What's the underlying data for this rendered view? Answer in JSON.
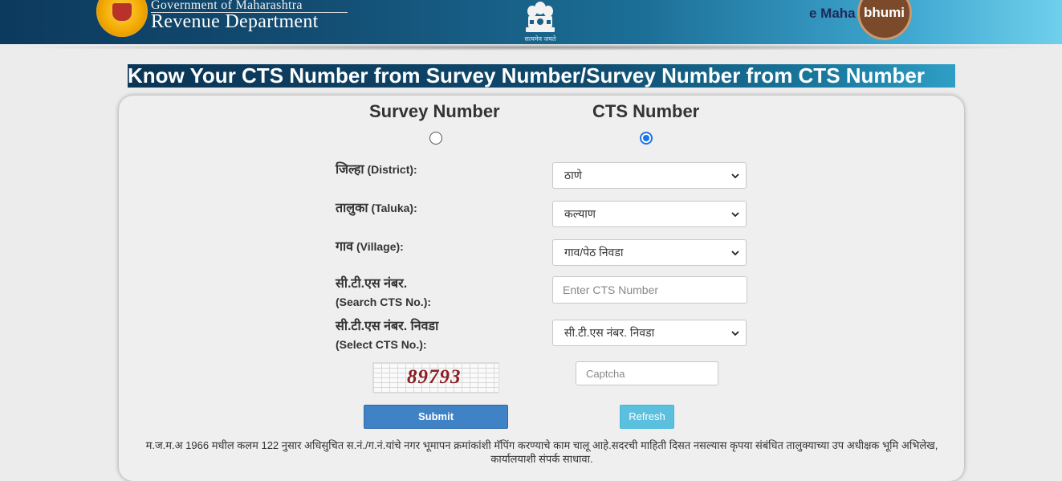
{
  "header": {
    "gov_line1": "Government of Maharashtra",
    "gov_line2": "Revenue Department",
    "emblem_caption": "सत्यमेव जयते",
    "brand_prefix": "e Maha",
    "brand_suffix": "bhumi"
  },
  "page_title": "Know Your CTS Number from Survey Number/Survey Number from CTS Number",
  "search_mode": {
    "options": [
      {
        "label": "Survey Number",
        "checked": false
      },
      {
        "label": "CTS Number",
        "checked": true
      }
    ]
  },
  "form": {
    "district": {
      "label_hi": "जिल्हा",
      "label_en": "(District):",
      "selected": "ठाणे"
    },
    "taluka": {
      "label_hi": "तालुका",
      "label_en": "(Taluka):",
      "selected": "कल्याण"
    },
    "village": {
      "label_hi": "गाव",
      "label_en": "(Village):",
      "selected": "गाव/पेठ निवडा"
    },
    "search_cts": {
      "label_hi": "सी.टी.एस नंबर.",
      "label_en": "(Search CTS No.):",
      "placeholder": "Enter CTS Number"
    },
    "select_cts": {
      "label_hi": "सी.टी.एस नंबर. निवडा",
      "label_en": "(Select CTS No.):",
      "selected": "सी.टी.एस नंबर. निवडा"
    },
    "captcha": {
      "image_text": "89793",
      "placeholder": "Captcha"
    }
  },
  "buttons": {
    "submit": "Submit",
    "refresh": "Refresh"
  },
  "note": "म.ज.म.अ 1966 मधील कलम 122 नुसार अधिसुचित स.नं./ग.नं.यांचे नगर भूमापन क्रमांकांशी मॅपिंग करण्याचे काम चालू आहे.सदरची माहिती दिसत नसल्यास कृपया संबंधित तालुक्याच्या उप अधीक्षक भूमि अभिलेख, कार्यालयाशी संपर्क साधावा."
}
